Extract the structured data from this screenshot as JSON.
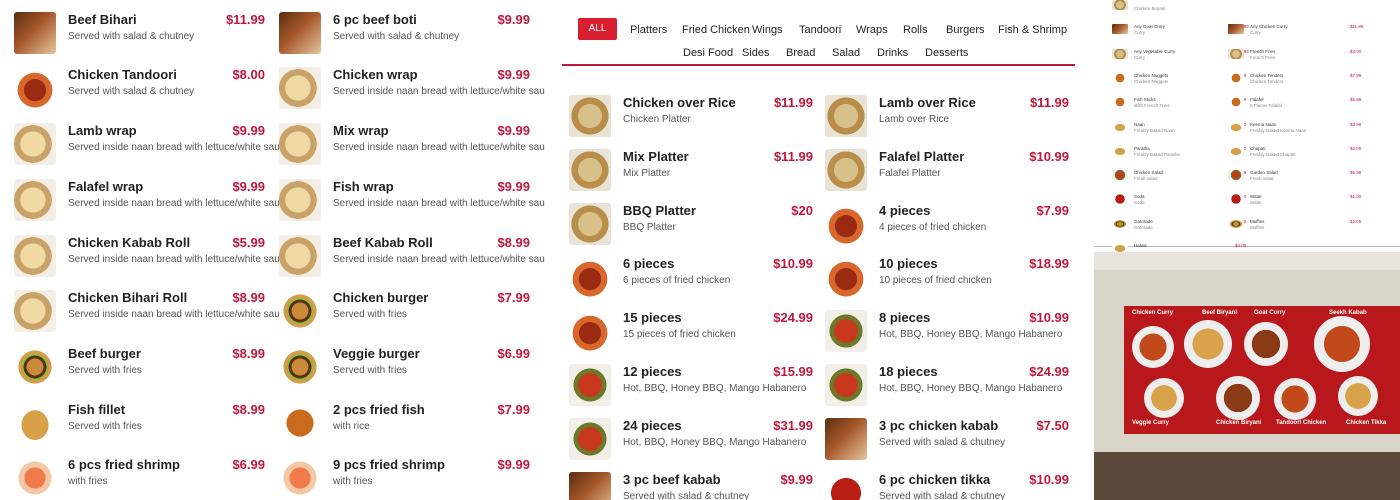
{
  "left_items": [
    {
      "name": "",
      "desc": "",
      "price": "",
      "thumb": "kabab"
    },
    {
      "name": "",
      "desc": "",
      "price": "",
      "thumb": "kabab"
    },
    {
      "name": "Beef Bihari",
      "desc": "Served with salad & chutney",
      "price": "$11.99",
      "thumb": "kabab"
    },
    {
      "name": "6 pc beef boti",
      "desc": "Served with salad & chutney",
      "price": "$9.99",
      "thumb": "kabab"
    },
    {
      "name": "Chicken Tandoori",
      "desc": "Served with salad & chutney",
      "price": "$8.00",
      "thumb": "wings"
    },
    {
      "name": "Chicken wrap",
      "desc": "Served inside naan bread with lettuce/white sauce",
      "price": "$9.99",
      "thumb": "wrap"
    },
    {
      "name": "Lamb wrap",
      "desc": "Served inside naan bread with lettuce/white sauce",
      "price": "$9.99",
      "thumb": "wrap"
    },
    {
      "name": "Mix wrap",
      "desc": "Served inside naan bread with lettuce/white sauce",
      "price": "$9.99",
      "thumb": "wrap"
    },
    {
      "name": "Falafel wrap",
      "desc": "Served inside naan bread with lettuce/white sauce",
      "price": "$9.99",
      "thumb": "wrap"
    },
    {
      "name": "Fish wrap",
      "desc": "Served inside naan bread with lettuce/white sauce",
      "price": "$9.99",
      "thumb": "wrap"
    },
    {
      "name": "Chicken Kabab Roll",
      "desc": "Served inside naan bread with lettuce/white sauce",
      "price": "$5.99",
      "thumb": "wrap"
    },
    {
      "name": "Beef Kabab Roll",
      "desc": "Served inside naan bread with lettuce/white sauce",
      "price": "$8.99",
      "thumb": "wrap"
    },
    {
      "name": "Chicken Bihari Roll",
      "desc": "Served inside naan bread with lettuce/white sauce",
      "price": "$8.99",
      "thumb": "wrap"
    },
    {
      "name": "Chicken burger",
      "desc": "Served with fries",
      "price": "$7.99",
      "thumb": "burger"
    },
    {
      "name": "Beef burger",
      "desc": "Served with fries",
      "price": "$8.99",
      "thumb": "burger"
    },
    {
      "name": "Veggie burger",
      "desc": "Served with fries",
      "price": "$6.99",
      "thumb": "burger"
    },
    {
      "name": "Fish fillet",
      "desc": "Served with fries",
      "price": "$8.99",
      "thumb": "fish"
    },
    {
      "name": "2 pcs fried fish",
      "desc": "with rice",
      "price": "$7.99",
      "thumb": "fried"
    },
    {
      "name": "6 pcs fried shrimp",
      "desc": "with fries",
      "price": "$6.99",
      "thumb": "shrimp"
    },
    {
      "name": "9 pcs fried shrimp",
      "desc": "with fries",
      "price": "$9.99",
      "thumb": "shrimp"
    }
  ],
  "tabs": {
    "row1": [
      "ALL",
      "Platters",
      "Fried Chicken",
      "Wings",
      "Tandoori",
      "Wraps",
      "Rolls",
      "Burgers",
      "Fish & Shrimp"
    ],
    "row2": [
      "Desi Food",
      "Sides",
      "Bread",
      "Salad",
      "Drinks",
      "Desserts"
    ],
    "active": "ALL",
    "accent": "#d91e2f"
  },
  "mid_items": [
    {
      "name": "Chicken over Rice",
      "desc": "Chicken Platter",
      "price": "$11.99",
      "thumb": "rice"
    },
    {
      "name": "Lamb over Rice",
      "desc": "Lamb over Rice",
      "price": "$11.99",
      "thumb": "rice"
    },
    {
      "name": "Mix Platter",
      "desc": "Mix Platter",
      "price": "$11.99",
      "thumb": "rice"
    },
    {
      "name": "Falafel Platter",
      "desc": "Falafel Platter",
      "price": "$10.99",
      "thumb": "rice"
    },
    {
      "name": "BBQ Platter",
      "desc": "BBQ Platter",
      "price": "$20",
      "thumb": "rice"
    },
    {
      "name": "4 pieces",
      "desc": "4 pieces of fried chicken",
      "price": "$7.99",
      "thumb": "wings"
    },
    {
      "name": "6 pieces",
      "desc": "6 pieces of fried chicken",
      "price": "$10.99",
      "thumb": "wings"
    },
    {
      "name": "10 pieces",
      "desc": "10 pieces of fried chicken",
      "price": "$18.99",
      "thumb": "wings"
    },
    {
      "name": "15 pieces",
      "desc": "15 pieces of fried chicken",
      "price": "$24.99",
      "thumb": "wings"
    },
    {
      "name": "8 pieces",
      "desc": "Hot, BBQ, Honey BBQ, Mango Habanero",
      "price": "$10.99",
      "thumb": "hot"
    },
    {
      "name": "12 pieces",
      "desc": "Hot, BBQ, Honey BBQ, Mango Habanero",
      "price": "$15.99",
      "thumb": "hot"
    },
    {
      "name": "18 pieces",
      "desc": "Hot, BBQ, Honey BBQ, Mango Habanero",
      "price": "$24.99",
      "thumb": "hot"
    },
    {
      "name": "24 pieces",
      "desc": "Hot, BBQ, Honey BBQ, Mango Habanero",
      "price": "$31.99",
      "thumb": "hot"
    },
    {
      "name": "3 pc chicken kabab",
      "desc": "Served with salad & chutney",
      "price": "$7.50",
      "thumb": "kabab"
    },
    {
      "name": "3 pc beef kabab",
      "desc": "Served with salad & chutney",
      "price": "$9.99",
      "thumb": "kabab"
    },
    {
      "name": "6 pc chicken tikka",
      "desc": "Served with salad & chutney",
      "price": "$10.99",
      "thumb": "tikka"
    }
  ],
  "menu_image": {
    "rows": [
      {
        "l_name": "",
        "l_desc": "Chicken Biryani",
        "l_price": "",
        "r_name": "",
        "r_desc": "",
        "r_price": ""
      },
      {
        "l_name": "Any Goat Curry",
        "l_desc": "Curry",
        "l_price": "$19.99",
        "r_name": "Any Chicken Curry",
        "r_desc": "Curry",
        "r_price": "$11.99"
      },
      {
        "l_name": "Any Vegetable Curry",
        "l_desc": "Curry",
        "l_price": "$10.99",
        "r_name": "French Fries",
        "r_desc": "French Fries",
        "r_price": "$3.00"
      },
      {
        "l_name": "Chicken Nuggets",
        "l_desc": "Chicken Nuggets",
        "l_price": "$5.99",
        "r_name": "Chicken Tenders",
        "r_desc": "Chicken Tenders",
        "r_price": "$7.99"
      },
      {
        "l_name": "Fish Sticks",
        "l_desc": "With French Fries",
        "l_price": "$6.99",
        "r_name": "Falafel",
        "r_desc": "6 Pieces Falafel",
        "r_price": "$5.99"
      },
      {
        "l_name": "Naan",
        "l_desc": "Freshly Baked Naan",
        "l_price": "$2.00",
        "r_name": "Keema Naan",
        "r_desc": "Freshly Baked Keema Naan",
        "r_price": "$3.99"
      },
      {
        "l_name": "Paratha",
        "l_desc": "Freshly Baked Paratha",
        "l_price": "$5.00",
        "r_name": "Chapati",
        "r_desc": "Freshly Baked Chapati",
        "r_price": "$2.00"
      },
      {
        "l_name": "Chicken Salad",
        "l_desc": "Fresh salad",
        "l_price": "$5.99",
        "r_name": "Garden Salad",
        "r_desc": "Fresh salad",
        "r_price": "$5.99"
      },
      {
        "l_name": "Soda",
        "l_desc": "Soda",
        "l_price": "$1.00",
        "r_name": "Water",
        "r_desc": "Water",
        "r_price": "$1.00"
      },
      {
        "l_name": "Gatorade",
        "l_desc": "Gatorade",
        "l_price": "$2.00",
        "r_name": "Muffins",
        "r_desc": "Muffins",
        "r_price": "$2.00"
      },
      {
        "l_name": "Halwa",
        "l_desc": "",
        "l_price": "$4.00",
        "r_name": "",
        "r_desc": "",
        "r_price": ""
      }
    ]
  },
  "photo": {
    "labels": [
      "Chicken Curry",
      "Beef Biryani",
      "Goat Curry",
      "Seekh Kabab",
      "Veggie Curry",
      "Chicken Biryani",
      "Tandoori Chicken",
      "Chicken Tikka"
    ],
    "banner_color": "#b8181c"
  }
}
